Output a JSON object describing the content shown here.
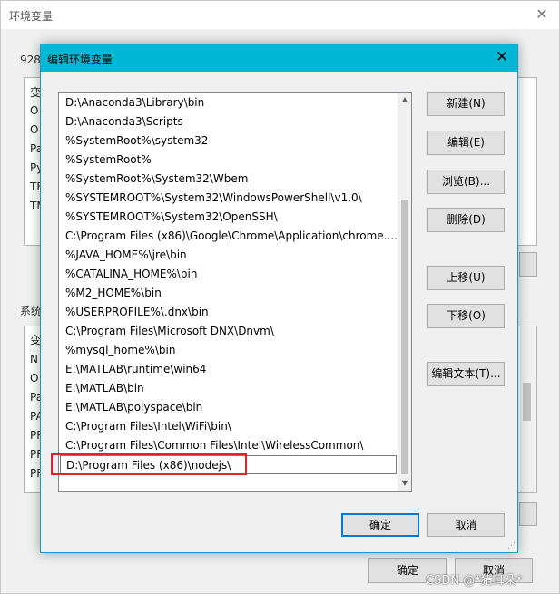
{
  "background": {
    "title": "环境变量",
    "user_group_label": "928",
    "user_rows": [
      "变",
      "O",
      "O",
      "Pa",
      "Py",
      "TE",
      "TM"
    ],
    "system_group_label": "系统",
    "system_rows": [
      "变",
      "N",
      "O",
      "Pa",
      "PA",
      "PR",
      "PR",
      "PR"
    ],
    "ok_label": "确定",
    "cancel_label": "取消"
  },
  "dialog": {
    "title": "编辑环境变量",
    "paths": [
      "D:\\Anaconda3\\Library\\bin",
      "D:\\Anaconda3\\Scripts",
      "%SystemRoot%\\system32",
      "%SystemRoot%",
      "%SystemRoot%\\System32\\Wbem",
      "%SYSTEMROOT%\\System32\\WindowsPowerShell\\v1.0\\",
      "%SYSTEMROOT%\\System32\\OpenSSH\\",
      "C:\\Program Files (x86)\\Google\\Chrome\\Application\\chrome....",
      "%JAVA_HOME%\\jre\\bin",
      "%CATALINA_HOME%\\bin",
      "%M2_HOME%\\bin",
      "%USERPROFILE%\\.dnx\\bin",
      "C:\\Program Files\\Microsoft DNX\\Dnvm\\",
      "%mysql_home%\\bin",
      "E:\\MATLAB\\runtime\\win64",
      "E:\\MATLAB\\bin",
      "E:\\MATLAB\\polyspace\\bin",
      "C:\\Program Files\\Intel\\WiFi\\bin\\",
      "C:\\Program Files\\Common Files\\Intel\\WirelessCommon\\",
      "D:\\Program Files (x86)\\nodejs\\"
    ],
    "buttons": {
      "new": "新建(N)",
      "edit": "编辑(E)",
      "browse": "浏览(B)...",
      "delete": "删除(D)",
      "move_up": "上移(U)",
      "move_down": "下移(O)",
      "edit_text": "编辑文本(T)...",
      "ok": "确定",
      "cancel": "取消"
    }
  },
  "watermark": "CSDN @*猪耳朵*",
  "colors": {
    "titlebar": "#00b8d4",
    "highlight_box": "#e0242a",
    "default_button_border": "#0078d7"
  }
}
